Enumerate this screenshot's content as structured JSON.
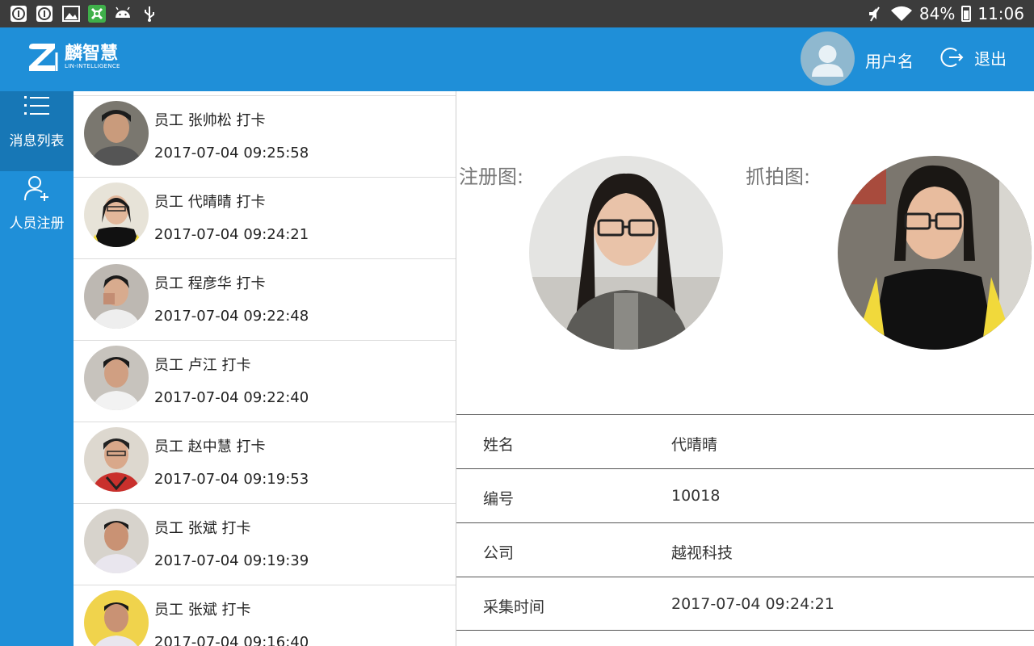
{
  "status_bar": {
    "battery": "84%",
    "time": "11:06",
    "left_icons": [
      "info-circle-icon",
      "info-circle-icon",
      "image-icon",
      "app-icon",
      "android-icon",
      "usb-icon"
    ],
    "right_icons": [
      "mute-icon",
      "wifi-icon",
      "battery-icon"
    ]
  },
  "header": {
    "logo_name": "麟智慧",
    "logo_sub": "LIN-INTELLIGENCE",
    "username": "用户名",
    "logout_label": "退出",
    "bg_color": "#1f8fd8"
  },
  "nav": {
    "items": [
      {
        "label": "消息列表",
        "icon": "list-icon",
        "active": true
      },
      {
        "label": "人员注册",
        "icon": "add-user-icon",
        "active": false
      }
    ]
  },
  "messages": [
    {
      "title": "员工 张帅松 打卡",
      "time": "2017-07-04 09:25:58"
    },
    {
      "title": "员工 代晴晴 打卡",
      "time": "2017-07-04 09:24:21"
    },
    {
      "title": "员工 程彦华 打卡",
      "time": "2017-07-04 09:22:48"
    },
    {
      "title": "员工 卢江 打卡",
      "time": "2017-07-04 09:22:40"
    },
    {
      "title": "员工 赵中慧 打卡",
      "time": "2017-07-04 09:19:53"
    },
    {
      "title": "员工 张斌 打卡",
      "time": "2017-07-04 09:19:39"
    },
    {
      "title": "员工 张斌 打卡",
      "time": "2017-07-04 09:16:40"
    }
  ],
  "detail": {
    "registered_label": "注册图:",
    "captured_label": "抓拍图:",
    "rows": [
      {
        "key": "姓名",
        "value": "代晴晴"
      },
      {
        "key": "编号",
        "value": "10018"
      },
      {
        "key": "公司",
        "value": "越视科技"
      },
      {
        "key": "采集时间",
        "value": "2017-07-04 09:24:21"
      }
    ]
  }
}
